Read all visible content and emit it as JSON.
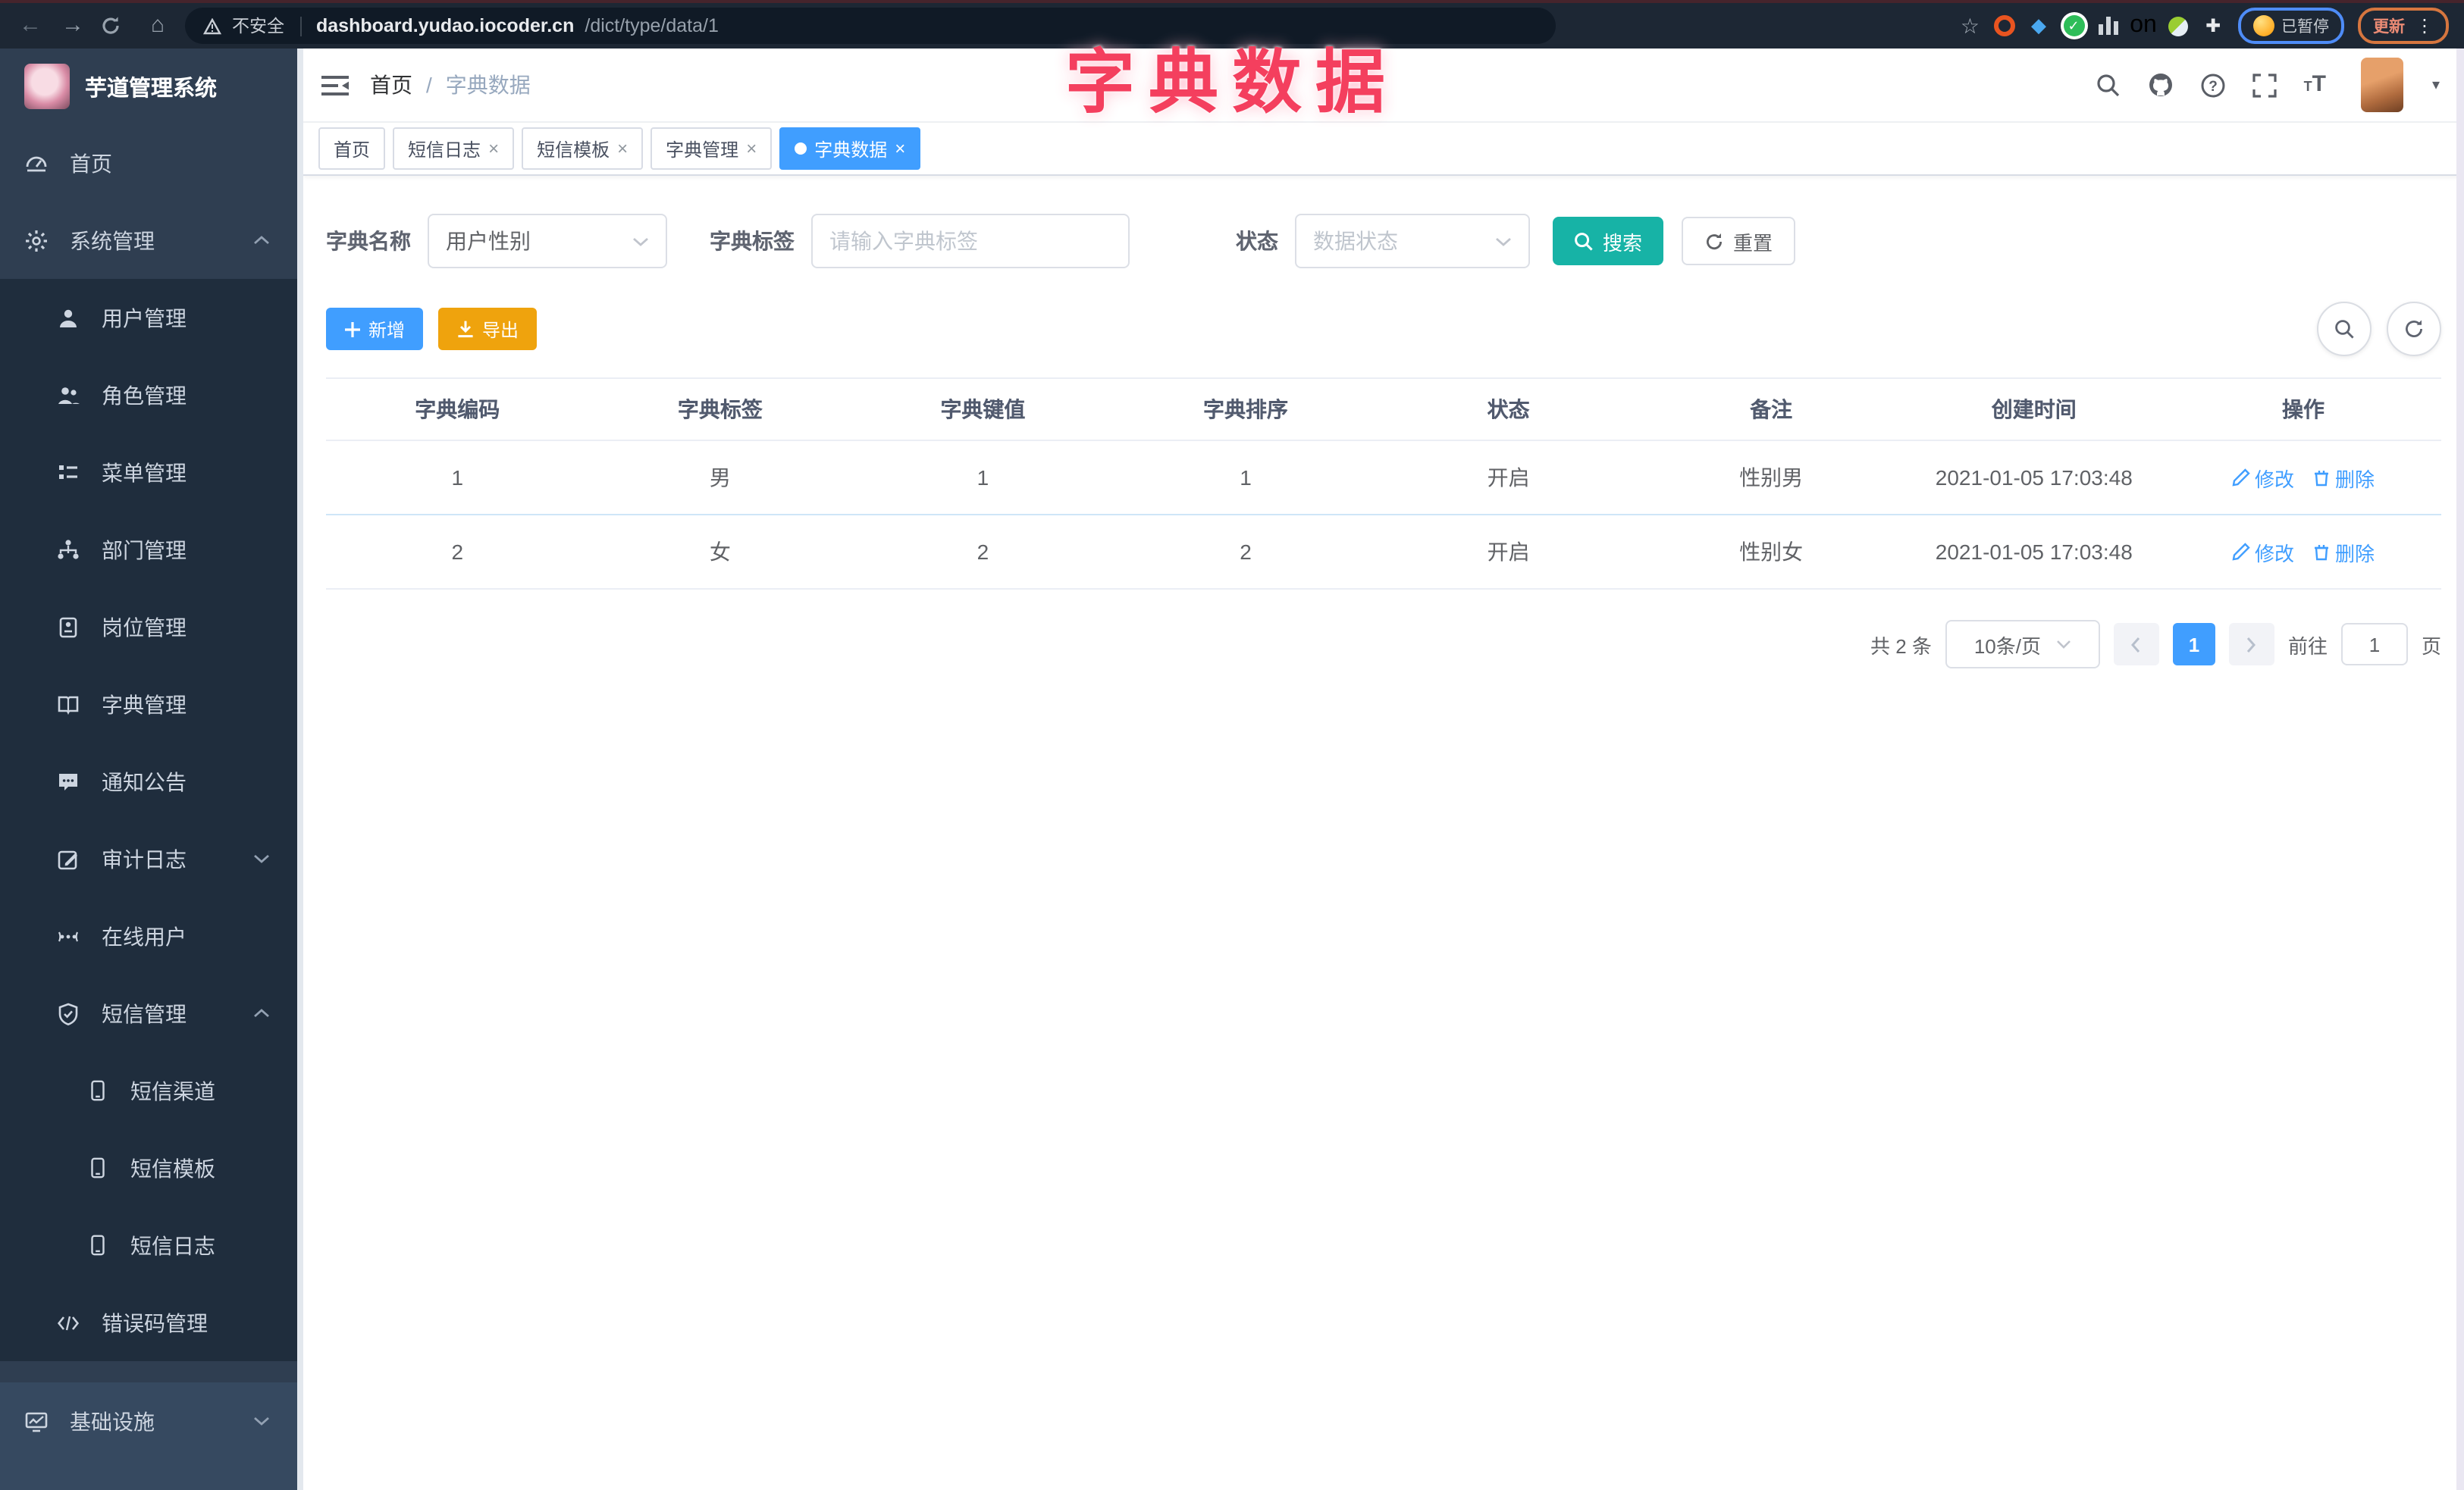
{
  "colors": {
    "primary": "#409eff",
    "search_teal": "#17b3a6",
    "export_orange": "#efa30d",
    "annotation_pink": "#f43f5e",
    "sidebar_bg": "#2f3e51",
    "submenu_bg": "#1f2d3d",
    "active_tab": "#409eff"
  },
  "browser": {
    "security_label": "不安全",
    "url_host": "dashboard.yudao.iocoder.cn",
    "url_path": "/dict/type/data/1",
    "extension_badge": "on",
    "profile_status": "已暂停",
    "update_label": "更新"
  },
  "overlay_title": "字典数据",
  "sidebar": {
    "logo_title": "芋道管理系统",
    "items": [
      {
        "label": "首页",
        "icon": "dashboard-icon",
        "level": 1
      },
      {
        "label": "系统管理",
        "icon": "gear-icon",
        "level": 1,
        "state": "expanded"
      },
      {
        "label": "用户管理",
        "icon": "user-icon",
        "level": 2
      },
      {
        "label": "角色管理",
        "icon": "role-users-icon",
        "level": 2
      },
      {
        "label": "菜单管理",
        "icon": "menu-list-icon",
        "level": 2
      },
      {
        "label": "部门管理",
        "icon": "org-tree-icon",
        "level": 2
      },
      {
        "label": "岗位管理",
        "icon": "post-badge-icon",
        "level": 2
      },
      {
        "label": "字典管理",
        "icon": "dict-book-icon",
        "level": 2
      },
      {
        "label": "通知公告",
        "icon": "notice-message-icon",
        "level": 2
      },
      {
        "label": "审计日志",
        "icon": "audit-log-icon",
        "level": 2,
        "state": "collapsed"
      },
      {
        "label": "在线用户",
        "icon": "online-user-icon",
        "level": 2
      },
      {
        "label": "短信管理",
        "icon": "sms-shield-icon",
        "level": 2,
        "state": "expanded"
      },
      {
        "label": "短信渠道",
        "icon": "phone-icon",
        "level": 3
      },
      {
        "label": "短信模板",
        "icon": "phone-icon",
        "level": 3
      },
      {
        "label": "短信日志",
        "icon": "phone-icon",
        "level": 3
      },
      {
        "label": "错误码管理",
        "icon": "code-icon",
        "level": 2
      },
      {
        "label": "基础设施",
        "icon": "monitor-icon",
        "level": 1,
        "state": "collapsed"
      }
    ]
  },
  "header": {
    "breadcrumb": [
      "首页",
      "字典数据"
    ]
  },
  "tabs": [
    {
      "label": "首页",
      "closable": false,
      "active": false
    },
    {
      "label": "短信日志",
      "closable": true,
      "active": false
    },
    {
      "label": "短信模板",
      "closable": true,
      "active": false
    },
    {
      "label": "字典管理",
      "closable": true,
      "active": false
    },
    {
      "label": "字典数据",
      "closable": true,
      "active": true
    }
  ],
  "filters": {
    "dict_name": {
      "label": "字典名称",
      "value": "用户性别"
    },
    "dict_label": {
      "label": "字典标签",
      "placeholder": "请输入字典标签"
    },
    "status": {
      "label": "状态",
      "placeholder": "数据状态"
    },
    "search": "搜索",
    "reset": "重置"
  },
  "toolbar": {
    "add": "新增",
    "export": "导出"
  },
  "table": {
    "headers": [
      "字典编码",
      "字典标签",
      "字典键值",
      "字典排序",
      "状态",
      "备注",
      "创建时间",
      "操作"
    ],
    "rows": [
      {
        "code": "1",
        "label": "男",
        "value": "1",
        "sort": "1",
        "status": "开启",
        "remark": "性别男",
        "created_at": "2021-01-05 17:03:48",
        "edit": "修改",
        "delete": "删除"
      },
      {
        "code": "2",
        "label": "女",
        "value": "2",
        "sort": "2",
        "status": "开启",
        "remark": "性别女",
        "created_at": "2021-01-05 17:03:48",
        "edit": "修改",
        "delete": "删除"
      }
    ]
  },
  "pagination": {
    "total": "共 2 条",
    "page_size": "10条/页",
    "current_page": "1",
    "goto": "前往",
    "goto_value": "1",
    "page_unit": "页"
  }
}
